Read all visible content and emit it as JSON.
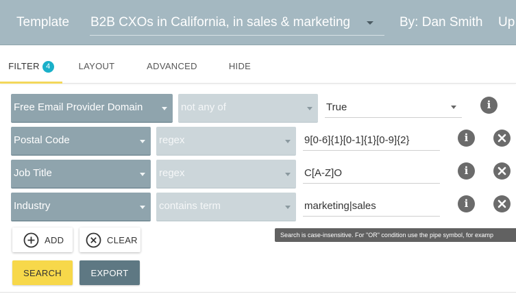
{
  "header": {
    "template_label": "Template",
    "template_value": "B2B CXOs in California, in sales & marketing",
    "byline": "By: Dan Smith",
    "truncated_next": "Up"
  },
  "tabs": [
    {
      "label": "FILTER",
      "badge": "4",
      "active": true
    },
    {
      "label": "LAYOUT"
    },
    {
      "label": "ADVANCED"
    },
    {
      "label": "HIDE"
    }
  ],
  "filters": [
    {
      "field": "Free Email Provider Domain",
      "operator": "not any of",
      "value": "True"
    },
    {
      "field": "Postal Code",
      "operator": "regex",
      "value": "9[0-6]{1}[0-1]{1}[0-9]{2}"
    },
    {
      "field": "Job Title",
      "operator": "regex",
      "value": "C[A-Z]O"
    },
    {
      "field": "Industry",
      "operator": "contains term",
      "value": "marketing|sales"
    }
  ],
  "buttons": {
    "add": "ADD",
    "clear": "CLEAR",
    "search": "SEARCH",
    "export": "EXPORT"
  },
  "tooltip": "Search is case-insensitive. For \"OR\" condition use the pipe symbol, for examp",
  "icons": {
    "info": "info-icon",
    "remove": "close-icon",
    "add": "plus-circle-icon",
    "clear": "x-circle-icon"
  },
  "colors": {
    "header_bg": "#a4b8c1",
    "field_bg": "#8fa4ad",
    "operator_bg": "#ccd6da",
    "badge": "#1ab0c9",
    "active_tab_underline": "#f3d75a",
    "search_button": "#f7d84a",
    "export_button": "#5e7883"
  }
}
